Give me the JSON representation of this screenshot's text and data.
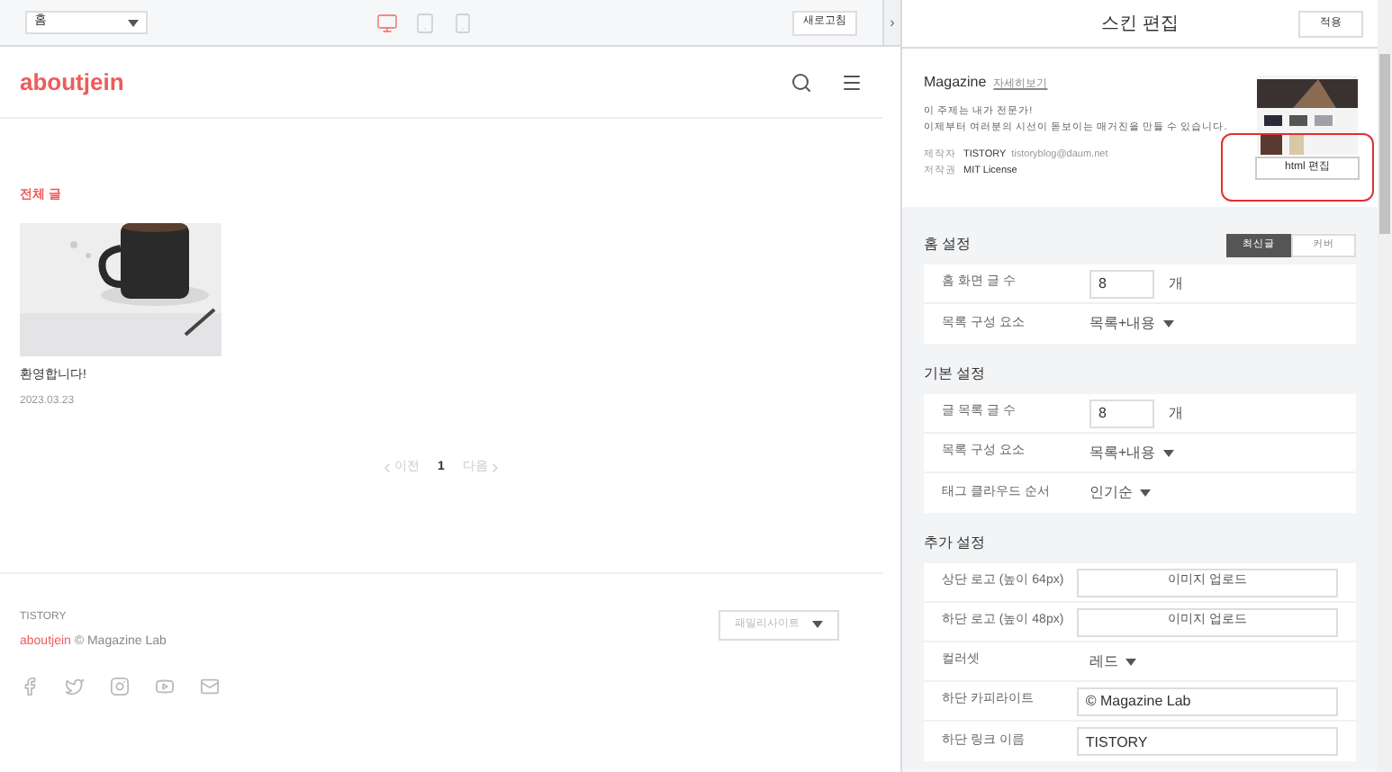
{
  "toolbar": {
    "page_select": "홈",
    "devices": [
      {
        "kind": "desktop",
        "selected": true
      },
      {
        "kind": "tablet",
        "selected": false
      },
      {
        "kind": "mobile",
        "selected": false
      }
    ],
    "refresh_button": "새로고침",
    "collapse": "›"
  },
  "preview": {
    "logo": "aboutjein",
    "category": "전체 글",
    "posts": [
      {
        "title": "환영합니다!",
        "date": "2023.03.23"
      }
    ],
    "pagination": {
      "prev": "이전",
      "pages": [
        {
          "label": "1",
          "selected": true
        }
      ],
      "next": "다음"
    },
    "footer": {
      "brand": "TISTORY",
      "blog": "aboutjein",
      "copyright": "© Magazine Lab",
      "family_site": "패밀리사이트"
    }
  },
  "editor": {
    "title": "스킨 편집",
    "apply_button": "적용",
    "skin": {
      "name": "Magazine",
      "details_link": "자세히보기",
      "description": [
        "이 주제는 내가 전문가!",
        "이제부터 여러분의 시선이 돋보이는 매거진을 만들 수 있습니다."
      ],
      "meta": [
        {
          "label": "제작자",
          "value": "TISTORY",
          "extra": "tistoryblog@daum.net"
        },
        {
          "label": "저작권",
          "value": "MIT License"
        }
      ],
      "html_button": "html 편집",
      "highlighted": true
    },
    "sections": [
      {
        "title": "홈 설정",
        "toggle": [
          {
            "label": "최신글",
            "selected": true
          },
          {
            "label": "커버",
            "selected": false
          }
        ],
        "rows": [
          {
            "kind": "number",
            "label": "홈 화면 글 수",
            "value": "8",
            "unit": "개"
          },
          {
            "kind": "dropdown",
            "label": "목록 구성 요소",
            "value": "목록+내용"
          }
        ]
      },
      {
        "title": "기본 설정",
        "rows": [
          {
            "kind": "number",
            "label": "글 목록 글 수",
            "value": "8",
            "unit": "개"
          },
          {
            "kind": "dropdown",
            "label": "목록 구성 요소",
            "value": "목록+내용"
          },
          {
            "kind": "dropdown",
            "label": "태그 클라우드 순서",
            "value": "인기순"
          }
        ]
      },
      {
        "title": "추가 설정",
        "rows": [
          {
            "kind": "upload",
            "label": "상단 로고 (높이 64px)",
            "value": "이미지 업로드"
          },
          {
            "kind": "upload",
            "label": "하단 로고 (높이 48px)",
            "value": "이미지 업로드"
          },
          {
            "kind": "dropdown",
            "label": "컬러셋",
            "value": "레드"
          },
          {
            "kind": "text",
            "label": "하단 카피라이트",
            "value": "© Magazine Lab"
          },
          {
            "kind": "text",
            "label": "하단 링크 이름",
            "value": "TISTORY"
          }
        ]
      }
    ]
  }
}
